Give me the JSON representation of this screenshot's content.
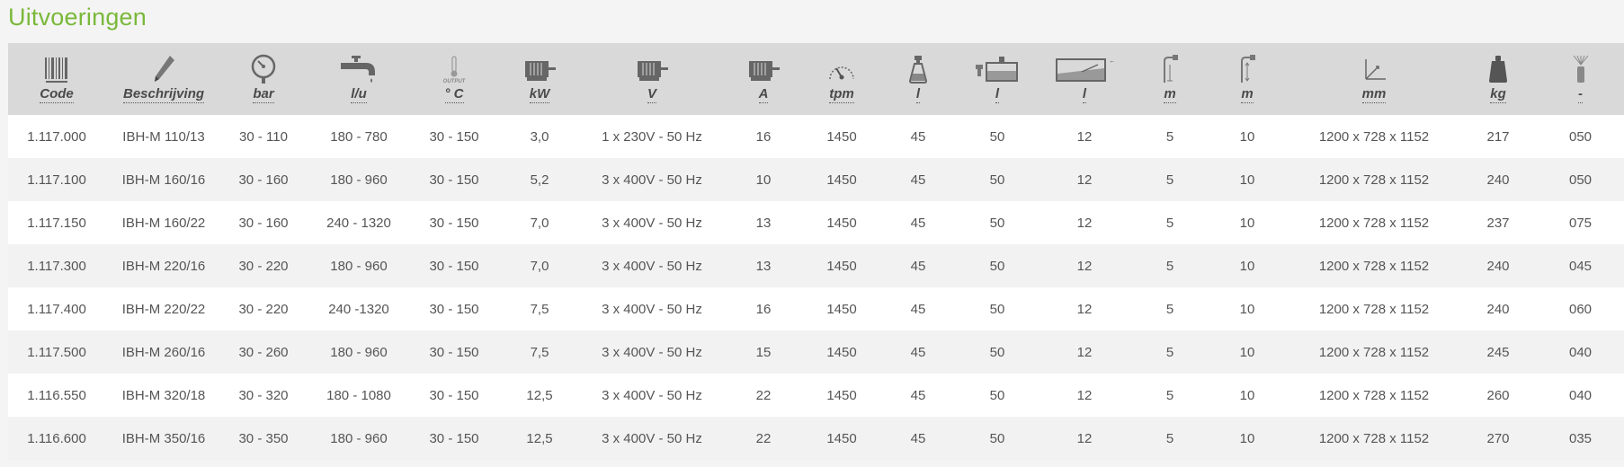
{
  "section": {
    "title": "Uitvoeringen"
  },
  "colors": {
    "title_green": "#7ab83a",
    "header_bg": "#d9d9d9",
    "icon_gray": "#666666",
    "row_alt": "#f2f2f2"
  },
  "table": {
    "headers": [
      {
        "label": "Code",
        "icon": "barcode-icon"
      },
      {
        "label": "Beschrijving",
        "icon": "pen-icon"
      },
      {
        "label": "bar",
        "icon": "pressure-gauge-icon"
      },
      {
        "label": "l/u",
        "icon": "faucet-icon"
      },
      {
        "label": "° C",
        "icon": "thermometer-icon",
        "icon_caption": "OUTPUT"
      },
      {
        "label": "kW",
        "icon": "motor-icon"
      },
      {
        "label": "V",
        "icon": "motor-icon"
      },
      {
        "label": "A",
        "icon": "motor-icon"
      },
      {
        "label": "tpm",
        "icon": "speedometer-icon"
      },
      {
        "label": "l",
        "icon": "spray-bottle-icon"
      },
      {
        "label": "l",
        "icon": "water-tank-icon"
      },
      {
        "label": "l",
        "icon": "fuel-tank-icon"
      },
      {
        "label": "m",
        "icon": "hose-height-icon"
      },
      {
        "label": "m",
        "icon": "hose-length-icon"
      },
      {
        "label": "mm",
        "icon": "dimensions-icon"
      },
      {
        "label": "kg",
        "icon": "weight-icon"
      },
      {
        "label": "-",
        "icon": "nozzle-icon"
      }
    ],
    "rows": [
      [
        "1.117.000",
        "IBH-M 110/13",
        "30 - 110",
        "180 - 780",
        "30 - 150",
        "3,0",
        "1 x 230V - 50 Hz",
        "16",
        "1450",
        "45",
        "50",
        "12",
        "5",
        "10",
        "1200 x 728 x 1152",
        "217",
        "050"
      ],
      [
        "1.117.100",
        "IBH-M 160/16",
        "30 - 160",
        "180 - 960",
        "30 - 150",
        "5,2",
        "3 x 400V - 50 Hz",
        "10",
        "1450",
        "45",
        "50",
        "12",
        "5",
        "10",
        "1200 x 728 x 1152",
        "240",
        "050"
      ],
      [
        "1.117.150",
        "IBH-M 160/22",
        "30 - 160",
        "240 - 1320",
        "30 - 150",
        "7,0",
        "3 x 400V - 50 Hz",
        "13",
        "1450",
        "45",
        "50",
        "12",
        "5",
        "10",
        "1200 x 728 x 1152",
        "237",
        "075"
      ],
      [
        "1.117.300",
        "IBH-M 220/16",
        "30 - 220",
        "180 - 960",
        "30 - 150",
        "7,0",
        "3 x 400V - 50 Hz",
        "13",
        "1450",
        "45",
        "50",
        "12",
        "5",
        "10",
        "1200 x 728 x 1152",
        "240",
        "045"
      ],
      [
        "1.117.400",
        "IBH-M 220/22",
        "30 - 220",
        "240 -1320",
        "30 - 150",
        "7,5",
        "3 x 400V - 50 Hz",
        "16",
        "1450",
        "45",
        "50",
        "12",
        "5",
        "10",
        "1200 x 728 x 1152",
        "240",
        "060"
      ],
      [
        "1.117.500",
        "IBH-M 260/16",
        "30 - 260",
        "180 - 960",
        "30 - 150",
        "7,5",
        "3 x 400V - 50 Hz",
        "15",
        "1450",
        "45",
        "50",
        "12",
        "5",
        "10",
        "1200 x 728 x 1152",
        "245",
        "040"
      ],
      [
        "1.116.550",
        "IBH-M 320/18",
        "30 - 320",
        "180 - 1080",
        "30 - 150",
        "12,5",
        "3 x 400V - 50 Hz",
        "22",
        "1450",
        "45",
        "50",
        "12",
        "5",
        "10",
        "1200 x 728 x 1152",
        "260",
        "040"
      ],
      [
        "1.116.600",
        "IBH-M 350/16",
        "30 - 350",
        "180 - 960",
        "30 - 150",
        "12,5",
        "3 x 400V - 50 Hz",
        "22",
        "1450",
        "45",
        "50",
        "12",
        "5",
        "10",
        "1200 x 728 x 1152",
        "270",
        "035"
      ]
    ]
  }
}
